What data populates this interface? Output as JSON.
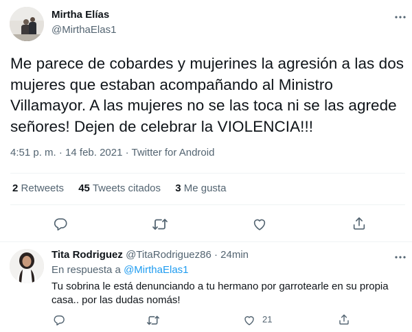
{
  "main_tweet": {
    "author_name": "Mirtha Elías",
    "author_handle": "@MirthaElas1",
    "text": "Me parece de cobardes y mujerines la agresión a las dos mujeres que estaban acompañando al Ministro Villamayor. A las mujeres no se las toca ni se las agrede señores! Dejen de celebrar la VIOLENCIA!!!",
    "time": "4:51 p. m.",
    "separator": "·",
    "date": "14 feb. 2021",
    "source": "Twitter for Android",
    "stats": {
      "retweets_count": "2",
      "retweets_label": "Retweets",
      "quotes_count": "45",
      "quotes_label": "Tweets citados",
      "likes_count": "3",
      "likes_label": "Me gusta"
    },
    "icons": [
      "reply-icon",
      "retweet-icon",
      "like-icon",
      "share-icon",
      "more-icon"
    ]
  },
  "reply": {
    "author_name": "Tita Rodriguez",
    "author_handle": "@TitaRodriguez86",
    "separator": "·",
    "time": "24min",
    "replying_prefix": "En respuesta a",
    "replying_mention": "@MirthaElas1",
    "text": "Tu sobrina le está denunciando a tu hermano por garrotearle en su propia casa.. por las dudas nomás!",
    "like_count": "21",
    "icons": [
      "reply-icon",
      "retweet-icon",
      "like-icon",
      "share-icon",
      "more-icon"
    ]
  },
  "colors": {
    "text_primary": "#0f1419",
    "text_secondary": "#536471",
    "link": "#1d9bf0",
    "divider": "#eff3f4"
  }
}
